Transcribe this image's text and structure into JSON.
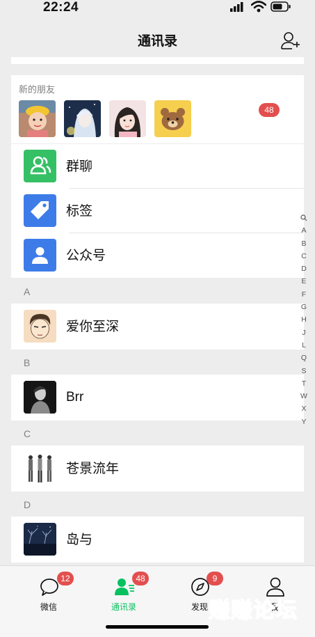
{
  "status_bar": {
    "time": "22:24"
  },
  "header": {
    "title": "通讯录"
  },
  "new_friends": {
    "label": "新的朋友",
    "badge": "48",
    "avatars": [
      "child-avatar",
      "anime-avatar",
      "girl-avatar",
      "bear-avatar"
    ]
  },
  "functions": [
    {
      "label": "群聊",
      "icon": "group-chat-icon",
      "color": "#35c065"
    },
    {
      "label": "标签",
      "icon": "tag-icon",
      "color": "#3d7ce8"
    },
    {
      "label": "公众号",
      "icon": "official-account-icon",
      "color": "#3d7ce8"
    }
  ],
  "sections": [
    {
      "letter": "A",
      "contacts": [
        {
          "name": "爱你至深"
        }
      ]
    },
    {
      "letter": "B",
      "contacts": [
        {
          "name": "Brr"
        }
      ]
    },
    {
      "letter": "C",
      "contacts": [
        {
          "name": "苍景流年"
        }
      ]
    },
    {
      "letter": "D",
      "contacts": [
        {
          "name": "岛与"
        }
      ]
    }
  ],
  "alpha_index": [
    "A",
    "B",
    "C",
    "D",
    "E",
    "F",
    "G",
    "H",
    "J",
    "L",
    "Q",
    "S",
    "T",
    "W",
    "X",
    "Y"
  ],
  "tabs": [
    {
      "label": "微信",
      "badge": "12",
      "icon": "chat-bubble-icon"
    },
    {
      "label": "通讯录",
      "badge": "48",
      "icon": "contacts-icon",
      "active": true
    },
    {
      "label": "发现",
      "badge": "9",
      "icon": "compass-icon"
    },
    {
      "label": "我",
      "badge": "",
      "icon": "person-icon"
    }
  ],
  "watermark": "赚赚论坛",
  "colors": {
    "accent": "#07c160",
    "badge": "#e34f4f",
    "background": "#ededed"
  }
}
